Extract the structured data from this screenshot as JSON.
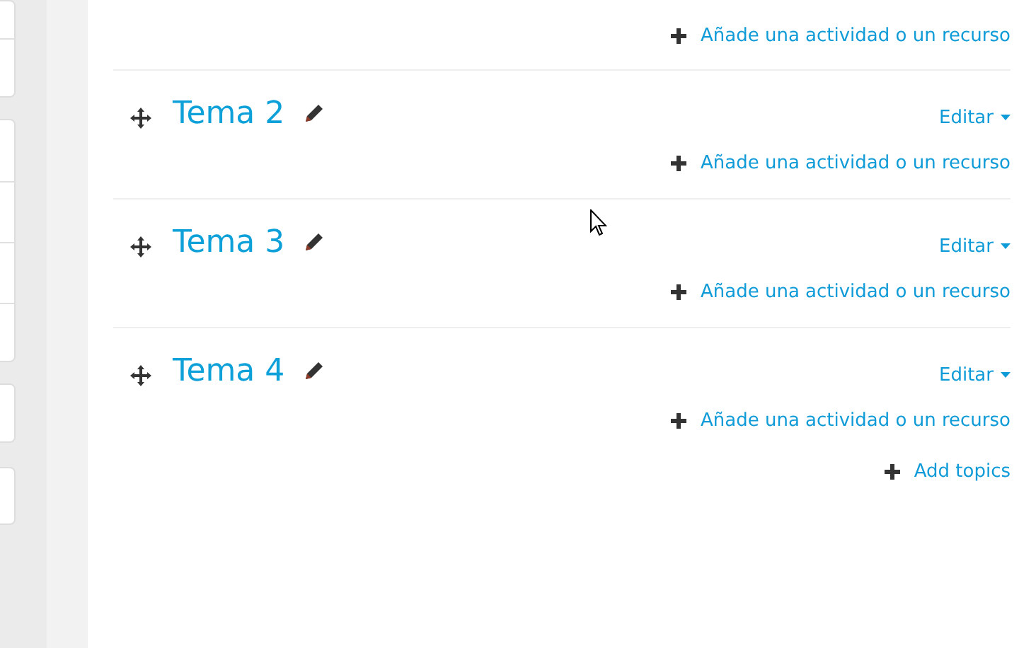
{
  "top_section": {
    "add_link": "Añade una actividad o un recurso"
  },
  "sections": [
    {
      "title": "Tema 2",
      "edit_label": "Editar",
      "add_link": "Añade una actividad o un recurso"
    },
    {
      "title": "Tema 3",
      "edit_label": "Editar",
      "add_link": "Añade una actividad o un recurso"
    },
    {
      "title": "Tema 4",
      "edit_label": "Editar",
      "add_link": "Añade una actividad o un recurso"
    }
  ],
  "add_topics": "Add topics"
}
